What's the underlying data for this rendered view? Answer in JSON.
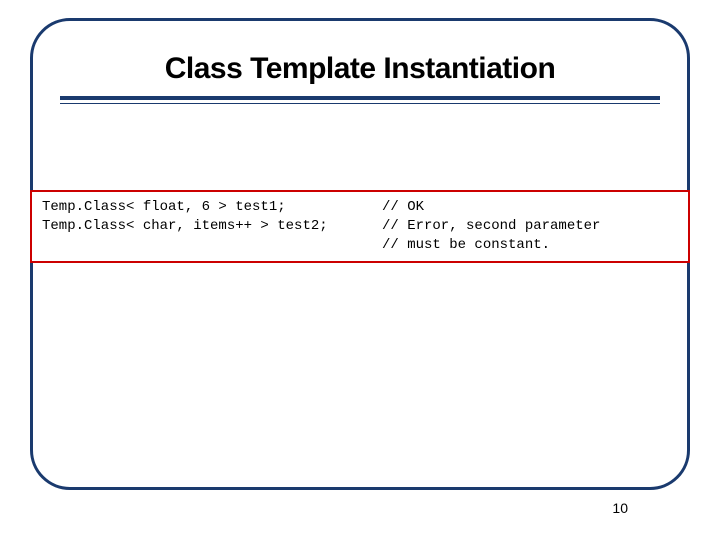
{
  "slide": {
    "title": "Class Template Instantiation",
    "code": {
      "line1_left": "Temp.Class< float, 6 > test1;",
      "line1_right": "// OK",
      "line2_left": "Temp.Class< char, items++ > test2;",
      "line2_right": "// Error, second parameter",
      "line3_left": "",
      "line3_right": "// must be constant."
    },
    "page_number": "10"
  }
}
